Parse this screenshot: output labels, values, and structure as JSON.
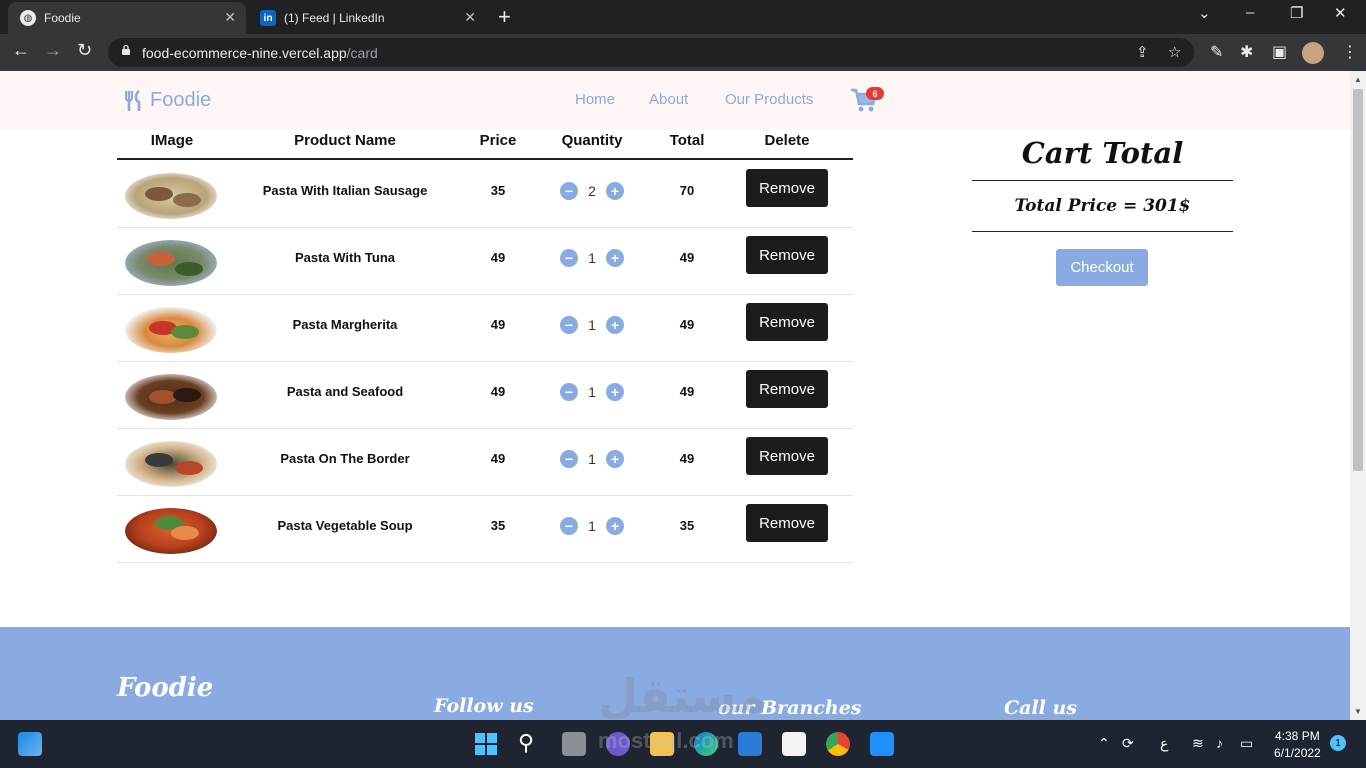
{
  "browser": {
    "tabs": [
      {
        "title": "Foodie",
        "active": true
      },
      {
        "title": "(1) Feed | LinkedIn",
        "active": false,
        "favicon_text": "in"
      }
    ],
    "url_host": "food-ecommerce-nine.vercel.app",
    "url_path": "/card"
  },
  "navbar": {
    "brand": "Foodie",
    "links": [
      "Home",
      "About",
      "Our Products"
    ],
    "cart_count": "6"
  },
  "table": {
    "headers": [
      "IMage",
      "Product Name",
      "Price",
      "Quantity",
      "Total",
      "Delete"
    ],
    "rows": [
      {
        "name": "Pasta With Italian Sausage",
        "price": "35",
        "qty": "2",
        "total": "70"
      },
      {
        "name": "Pasta With Tuna",
        "price": "49",
        "qty": "1",
        "total": "49"
      },
      {
        "name": "Pasta Margherita",
        "price": "49",
        "qty": "1",
        "total": "49"
      },
      {
        "name": "Pasta and Seafood",
        "price": "49",
        "qty": "1",
        "total": "49"
      },
      {
        "name": "Pasta On The Border",
        "price": "49",
        "qty": "1",
        "total": "49"
      },
      {
        "name": "Pasta Vegetable Soup",
        "price": "35",
        "qty": "1",
        "total": "35"
      }
    ],
    "minus_label": "−",
    "plus_label": "+",
    "remove_label": "Remove"
  },
  "cart_summary": {
    "title": "Cart Total",
    "total_label": "Total Price = 301$",
    "checkout_label": "Checkout"
  },
  "footer": {
    "brand": "Foodie",
    "col1": "Follow us",
    "col2": "our Branches",
    "col3": "Call us"
  },
  "watermark": {
    "arabic": "مستقل",
    "latin": "mostaql.com"
  },
  "taskbar": {
    "time": "4:38 PM",
    "date": "6/1/2022",
    "notifications": "1",
    "lang": "ع"
  },
  "colors": {
    "accent": "#8aaae2",
    "dark_button": "#1c1c1e",
    "badge": "#e53935",
    "navbar_bg": "#fdf6f4"
  }
}
